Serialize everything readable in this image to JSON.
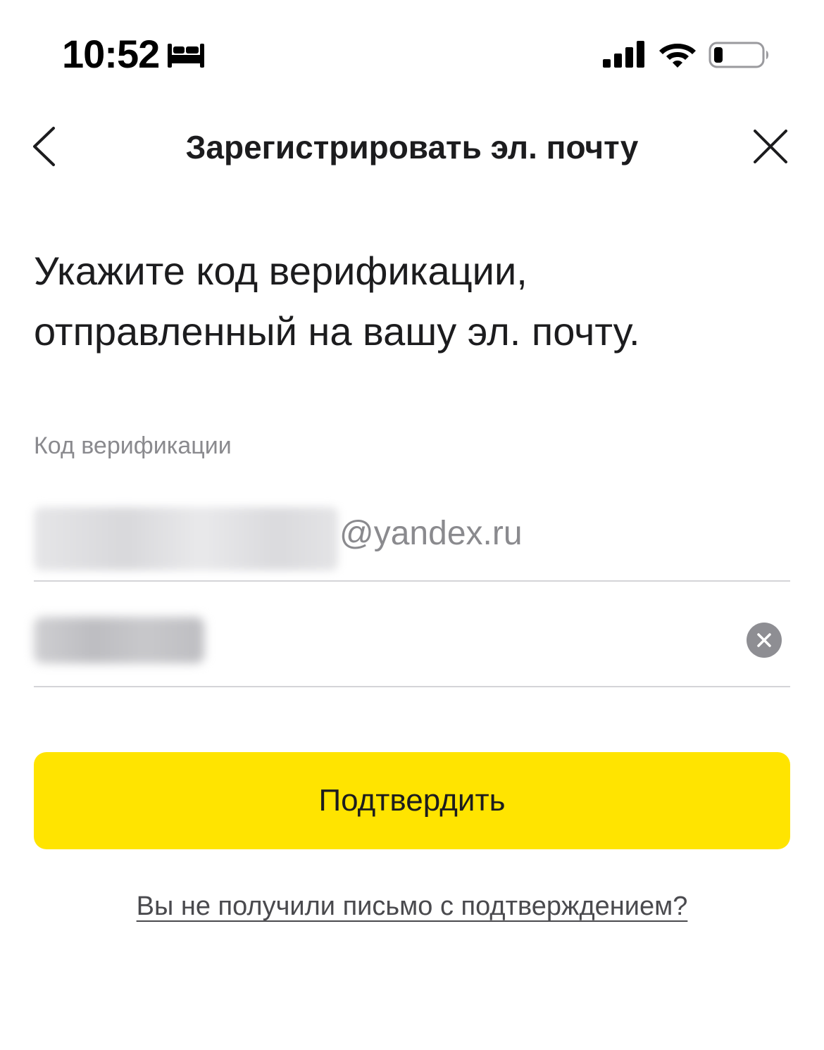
{
  "status_bar": {
    "time": "10:52",
    "focus_icon": "bed-icon",
    "signal_icon": "cellular-signal-icon",
    "wifi_icon": "wifi-icon",
    "battery_icon": "battery-low-icon",
    "battery_level": 0.15
  },
  "header": {
    "title": "Зарегистрировать эл. почту",
    "back_icon": "chevron-left-icon",
    "close_icon": "close-icon"
  },
  "main": {
    "instruction": "Укажите код верификации, отправленный на вашу эл. почту.",
    "field_label": "Код верификации",
    "email_domain": "@yandex.ru",
    "code_input_value": "",
    "clear_icon": "clear-circle-icon",
    "confirm_label": "Подтвердить",
    "resend_link": "Вы не получили письмо с подтверждением?"
  },
  "colors": {
    "accent": "#ffe400",
    "text_primary": "#1c1c1e",
    "text_secondary": "#8a8a8e",
    "divider": "#d4d4d8"
  }
}
